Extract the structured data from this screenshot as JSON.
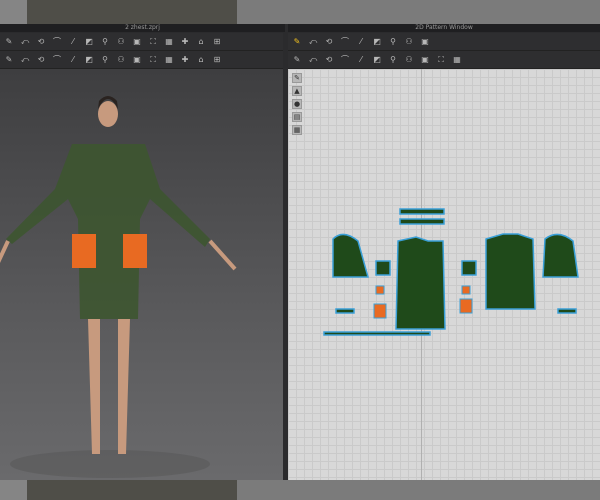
{
  "left_window": {
    "title": "2 zhest.zprj"
  },
  "right_window": {
    "title": "2D Pattern Window"
  },
  "toolbar_left_row1": [
    "move",
    "edit",
    "segment",
    "fold",
    "curve",
    "pin",
    "sew",
    "sew-free",
    "tack",
    "avatar",
    "body",
    "fit",
    "shirt",
    "shirt2"
  ],
  "toolbar_left_row2": [
    "sel",
    "puck",
    "fabric",
    "cut",
    "split",
    "fold2",
    "fold3",
    "button",
    "button2",
    "zip",
    "tape",
    "ruler",
    "bundle",
    "measure"
  ],
  "toolbar_right_row1": [
    "transform",
    "points",
    "create",
    "rect",
    "polygon",
    "circle",
    "internal",
    "grading",
    "grid"
  ],
  "toolbar_right_row2": [
    "segment",
    "fold",
    "fold2",
    "edit",
    "iron",
    "shirt",
    "arrange",
    "pin",
    "pin2",
    "line",
    "dashed"
  ],
  "side_tools": [
    "pen",
    "shirt",
    "color",
    "sheet",
    "layers"
  ],
  "colors": {
    "garment": "#1f4a1a",
    "pocket": "#e86a22",
    "outline": "#3aa0d8",
    "accent": "#f0c020"
  }
}
